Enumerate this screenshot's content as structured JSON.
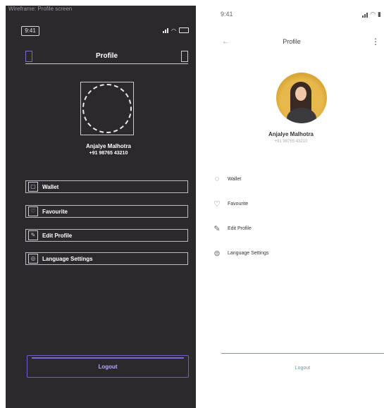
{
  "wireframe": {
    "caption": "Wireframe: Profile screen",
    "status": {
      "time": "9:41"
    },
    "header": {
      "title": "Profile"
    },
    "user": {
      "name": "Anjalye Malhotra",
      "phone": "+91 98765 43210"
    },
    "menu": [
      {
        "label": "Wallet",
        "icon": "wallet-icon"
      },
      {
        "label": "Favourite",
        "icon": "heart-icon"
      },
      {
        "label": "Edit Profile",
        "icon": "pencil-icon"
      },
      {
        "label": "Language Settings",
        "icon": "globe-icon"
      }
    ],
    "logout": "Logout"
  },
  "ui": {
    "status": {
      "time": "9:41",
      "icons": [
        "signal-icon",
        "wifi-icon",
        "battery-icon"
      ]
    },
    "header": {
      "title": "Profile"
    },
    "user": {
      "name": "Anjalye Malhotra",
      "phone": "+91 98765 43210"
    },
    "menu": [
      {
        "label": "Wallet",
        "icon": "wallet-icon"
      },
      {
        "label": "Favourite",
        "icon": "heart-icon"
      },
      {
        "label": "Edit Profile",
        "icon": "pencil-icon"
      },
      {
        "label": "Language Settings",
        "icon": "globe-icon"
      }
    ],
    "logout": "Logout",
    "accent_color": "#4a9fe9"
  },
  "colors": {
    "wire_bg": "#2b292c",
    "wire_accent": "#7a66d6",
    "ui_accent": "#4a9fe9"
  }
}
